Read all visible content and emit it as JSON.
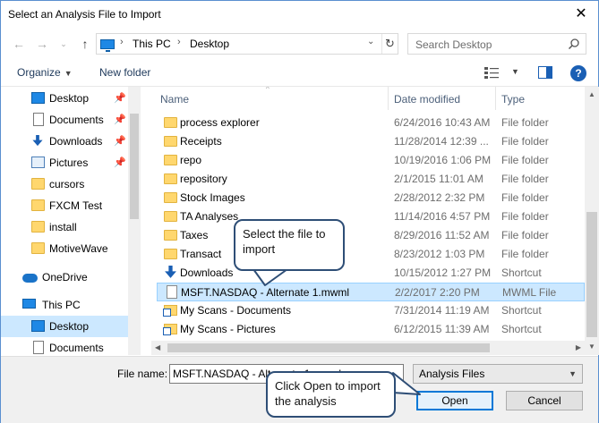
{
  "window": {
    "title": "Select an Analysis File to Import",
    "close_label": "✕"
  },
  "address": {
    "segments": [
      "This PC",
      "Desktop"
    ],
    "search_placeholder": "Search Desktop"
  },
  "toolbar": {
    "organize_label": "Organize",
    "new_folder_label": "New folder",
    "help_label": "?"
  },
  "nav_pane": {
    "items": [
      {
        "label": "Desktop",
        "icon": "desktop-icon",
        "pinned": true
      },
      {
        "label": "Documents",
        "icon": "documents-icon",
        "pinned": true
      },
      {
        "label": "Downloads",
        "icon": "downloads-icon",
        "pinned": true
      },
      {
        "label": "Pictures",
        "icon": "pictures-icon",
        "pinned": true
      },
      {
        "label": "cursors",
        "icon": "folder-icon",
        "pinned": false
      },
      {
        "label": "FXCM Test",
        "icon": "folder-icon",
        "pinned": false
      },
      {
        "label": "install",
        "icon": "folder-icon",
        "pinned": false
      },
      {
        "label": "MotiveWave",
        "icon": "folder-icon",
        "pinned": false
      },
      {
        "label": "OneDrive",
        "icon": "onedrive-icon",
        "pinned": false
      },
      {
        "label": "This PC",
        "icon": "this-pc-icon",
        "pinned": false
      },
      {
        "label": "Desktop",
        "icon": "desktop-icon",
        "pinned": false,
        "selected": true
      },
      {
        "label": "Documents",
        "icon": "documents-icon",
        "pinned": false
      }
    ]
  },
  "file_list": {
    "columns": {
      "name": "Name",
      "date": "Date modified",
      "type": "Type"
    },
    "rows": [
      {
        "name": "process explorer",
        "date": "6/24/2016 10:43 AM",
        "type": "File folder",
        "icon": "folder-icon"
      },
      {
        "name": "Receipts",
        "date": "11/28/2014 12:39 ...",
        "type": "File folder",
        "icon": "folder-icon"
      },
      {
        "name": "repo",
        "date": "10/19/2016 1:06 PM",
        "type": "File folder",
        "icon": "folder-icon"
      },
      {
        "name": "repository",
        "date": "2/1/2015 11:01 AM",
        "type": "File folder",
        "icon": "folder-icon"
      },
      {
        "name": "Stock Images",
        "date": "2/28/2012 2:32 PM",
        "type": "File folder",
        "icon": "folder-icon"
      },
      {
        "name": "TA Analyses",
        "date": "11/14/2016 4:57 PM",
        "type": "File folder",
        "icon": "folder-icon"
      },
      {
        "name": "Taxes",
        "date": "8/29/2016 11:52 AM",
        "type": "File folder",
        "icon": "folder-icon"
      },
      {
        "name": "Transact",
        "date": "8/23/2012 1:03 PM",
        "type": "File folder",
        "icon": "folder-icon"
      },
      {
        "name": "Downloads",
        "date": "10/15/2012 1:27 PM",
        "type": "Shortcut",
        "icon": "downloads-shortcut-icon"
      },
      {
        "name": "MSFT.NASDAQ - Alternate 1.mwml",
        "date": "2/2/2017 2:20 PM",
        "type": "MWML File",
        "icon": "file-icon",
        "selected": true
      },
      {
        "name": "My Scans - Documents",
        "date": "7/31/2014 11:19 AM",
        "type": "Shortcut",
        "icon": "shortcut-icon"
      },
      {
        "name": "My Scans - Pictures",
        "date": "6/12/2015 11:39 AM",
        "type": "Shortcut",
        "icon": "shortcut-icon"
      }
    ]
  },
  "bottom": {
    "file_name_label": "File name:",
    "file_name_value": "MSFT.NASDAQ - Alternate 1.mwml",
    "file_type_value": "Analysis Files",
    "open_label": "Open",
    "cancel_label": "Cancel"
  },
  "callouts": {
    "select_file": "Select the file to import",
    "click_open": "Click Open to import the analysis"
  },
  "colors": {
    "selection": "#cce8ff",
    "callout_border": "#2e4e76",
    "accent": "#0078d7"
  }
}
